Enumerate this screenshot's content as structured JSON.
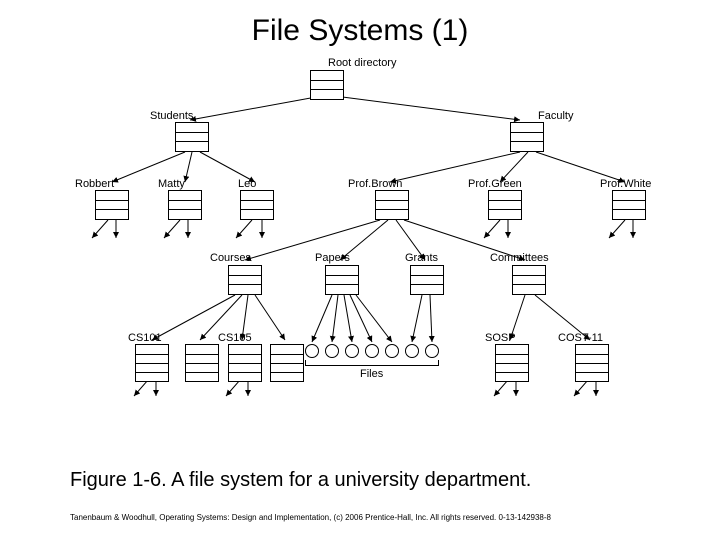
{
  "title": "File Systems (1)",
  "caption": "Figure 1-6. A file system for a university department.",
  "footer": "Tanenbaum & Woodhull, Operating Systems: Design and Implementation, (c) 2006 Prentice-Hall, Inc. All rights reserved. 0-13-142938-8",
  "labels": {
    "root": "Root directory",
    "students": "Students",
    "faculty": "Faculty",
    "robbert": "Robbert",
    "matty": "Matty",
    "leo": "Leo",
    "profbrown": "Prof.Brown",
    "profgreen": "Prof.Green",
    "profwhite": "Prof.White",
    "courses": "Courses",
    "papers": "Papers",
    "grants": "Grants",
    "committees": "Committees",
    "cs101": "CS101",
    "cs105": "CS105",
    "sosp": "SOSP",
    "cost11": "COST-11",
    "files": "Files"
  }
}
